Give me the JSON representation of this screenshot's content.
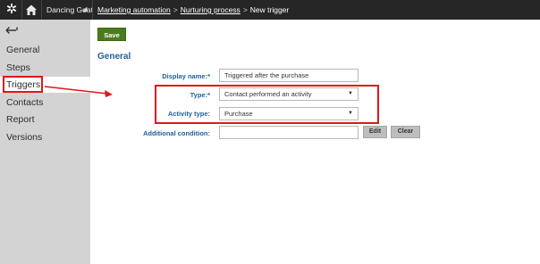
{
  "header": {
    "site_name": "Dancing Goat",
    "breadcrumb": [
      {
        "label": "Marketing automation"
      },
      {
        "label": "Nurturing process"
      },
      {
        "label": "New trigger"
      }
    ],
    "separator": ">"
  },
  "sidebar": {
    "items": [
      {
        "label": "General"
      },
      {
        "label": "Steps"
      },
      {
        "label": "Triggers"
      },
      {
        "label": "Contacts"
      },
      {
        "label": "Report"
      },
      {
        "label": "Versions"
      }
    ]
  },
  "toolbar": {
    "save_label": "Save"
  },
  "form": {
    "section_title": "General",
    "display_name_label": "Display name:*",
    "display_name_value": "Triggered after the purchase",
    "type_label": "Type:*",
    "type_value": "Contact performed an activity",
    "activity_type_label": "Activity type:",
    "activity_type_value": "Purchase",
    "additional_condition_label": "Additional condition:",
    "additional_condition_value": "",
    "edit_label": "Edit",
    "clear_label": "Clear"
  },
  "colors": {
    "topbar": "#262626",
    "sidebar": "#d3d3d3",
    "label_blue": "#1f5f9a",
    "save_green": "#4a7c1d",
    "highlight_red": "#e01818"
  },
  "icons": {
    "logo": "kentico-logo-icon",
    "home": "home-icon",
    "back": "back-arrow-icon",
    "dropdown": "chevron-down-icon"
  }
}
